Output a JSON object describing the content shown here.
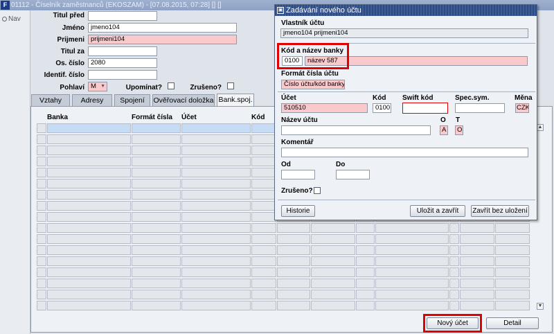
{
  "window": {
    "title": "01112 - Číselník zaměstnanců (EKOSZAM) - [07.08.2015, 07:28] [] []"
  },
  "nav": {
    "label": "Nav"
  },
  "form": {
    "titul_pred": {
      "label": "Titul před",
      "value": ""
    },
    "jmeno": {
      "label": "Jméno",
      "value": "jmeno104"
    },
    "prijmeni": {
      "label": "Prijmeni",
      "value": "prijmeni104"
    },
    "titul_za": {
      "label": "Titul za",
      "value": ""
    },
    "os_cislo": {
      "label": "Os. číslo",
      "value": "2080"
    },
    "identif_cislo": {
      "label": "Identif. číslo",
      "value": ""
    },
    "pohlavi": {
      "label": "Pohlaví",
      "value": "M"
    },
    "upominat": {
      "label": "Upomínat?"
    },
    "zruseno": {
      "label": "Zrušeno?"
    }
  },
  "tabs": [
    "Vztahy",
    "Adresy",
    "Spojení",
    "Ověřovací doložka",
    "Bank.spoj."
  ],
  "grid": {
    "headers": [
      "Banka",
      "Formát čísla",
      "Účet",
      "Kód"
    ]
  },
  "buttons": {
    "new_account": "Nový účet",
    "detail": "Detail"
  },
  "dialog": {
    "title": "Zadávání nového účtu",
    "owner_label": "Vlastník účtu",
    "owner_value": "jmeno104 prijmeni104",
    "bank_label": "Kód a název banky",
    "bank_code": "0100",
    "bank_name": "název 587",
    "format_label": "Formát čísla účtu",
    "format_value": "Číslo účtu/kód banky",
    "account_label": "Účet",
    "account_value": "510510",
    "code_label": "Kód",
    "code_value": "0100",
    "swift_label": "Swift kód",
    "swift_value": "",
    "spec_label": "Spec.sym.",
    "spec_value": "",
    "currency_label": "Měna",
    "currency_value": "CZK",
    "name_label": "Název účtu",
    "name_value": "",
    "o_label": "O",
    "o_value": "A",
    "t_label": "T",
    "t_value": "O",
    "comment_label": "Komentář",
    "comment_value": "",
    "from_label": "Od",
    "from_value": "",
    "to_label": "Do",
    "to_value": "",
    "cancelled_label": "Zrušeno?",
    "history_btn": "Historie",
    "save_btn": "Uložit a zavřít",
    "close_btn": "Zavřít bez uložení"
  },
  "colors": {
    "required_bg": "#f9c9cc",
    "dialog_title": "#2e4b84",
    "highlight": "#e00000"
  },
  "icons": {
    "app": "app-logo-icon",
    "dialog": "dialog-window-icon"
  }
}
